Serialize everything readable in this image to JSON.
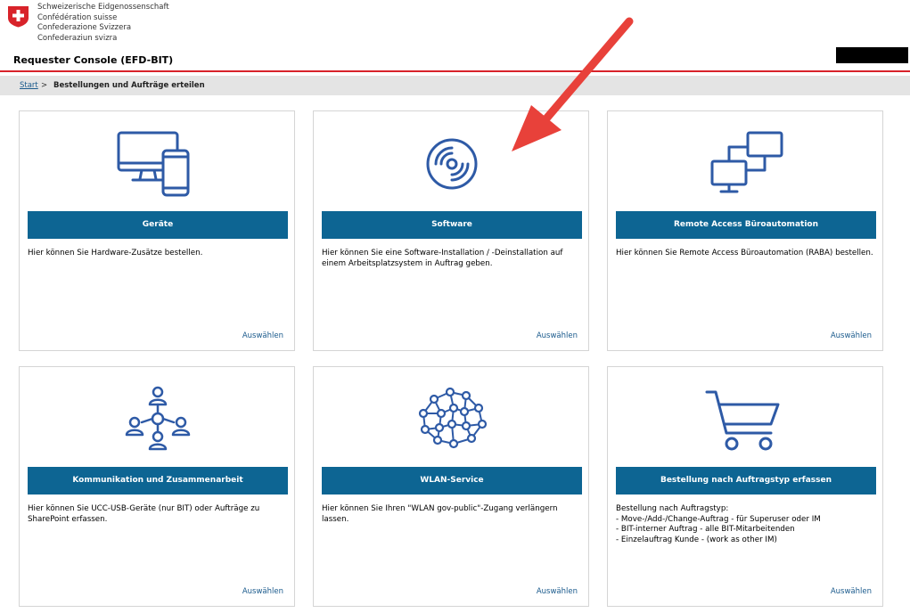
{
  "confederation": [
    "Schweizerische Eidgenossenschaft",
    "Confédération suisse",
    "Confederazione Svizzera",
    "Confederaziun svizra"
  ],
  "app_title": "Requester Console (EFD-BIT)",
  "breadcrumb": {
    "start": "Start",
    "separator": ">",
    "current": "Bestellungen und Aufträge erteilen"
  },
  "colors": {
    "accent_bar": "#0d6593",
    "header_line": "#d8232a",
    "icon_stroke": "#2e5aa6",
    "arrow": "#e8413a"
  },
  "tiles": [
    {
      "title": "Geräte",
      "icon": "devices-icon",
      "description": [
        "Hier können Sie Hardware-Zusätze bestellen."
      ],
      "select_label": "Auswählen"
    },
    {
      "title": "Software",
      "icon": "software-disc-icon",
      "description": [
        "Hier können Sie eine Software-Installation / -Deinstallation auf",
        "einem Arbeitsplatzsystem in Auftrag geben."
      ],
      "select_label": "Auswählen"
    },
    {
      "title": "Remote Access Büroautomation",
      "icon": "remote-access-icon",
      "description": [
        "Hier können Sie Remote Access Büroautomation (RABA) bestellen."
      ],
      "select_label": "Auswählen"
    },
    {
      "title": "Kommunikation und Zusammenarbeit",
      "icon": "people-network-icon",
      "description": [
        "Hier können Sie UCC-USB-Geräte (nur BIT) oder Aufträge zu",
        "SharePoint erfassen."
      ],
      "select_label": "Auswählen"
    },
    {
      "title": "WLAN-Service",
      "icon": "network-brain-icon",
      "description": [
        "Hier können Sie Ihren \"WLAN gov-public\"-Zugang verlängern",
        "lassen."
      ],
      "select_label": "Auswählen"
    },
    {
      "title": "Bestellung nach Auftragstyp erfassen",
      "icon": "shopping-cart-icon",
      "description": [
        "Bestellung nach Auftragstyp:",
        "- Move-/Add-/Change-Auftrag - für Superuser oder IM",
        "- BIT-interner Auftrag - alle BIT-Mitarbeitenden",
        "- Einzelauftrag Kunde - (work as other IM)"
      ],
      "select_label": "Auswählen"
    }
  ]
}
